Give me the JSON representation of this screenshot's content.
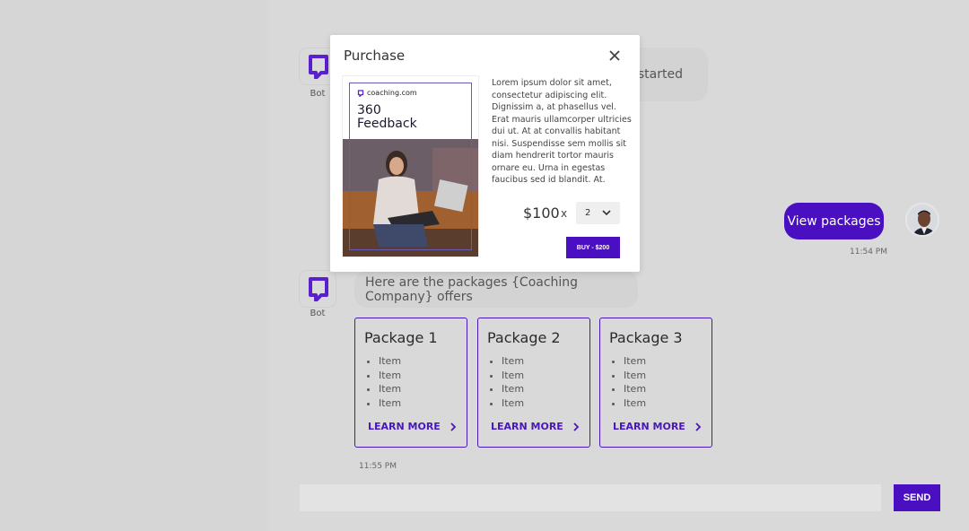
{
  "colors": {
    "accent": "#4a0fc0",
    "background": "#d9d9d9",
    "modal_bg": "#ffffff"
  },
  "chat": {
    "bot_label_1": "Bot",
    "bot_label_2": "Bot",
    "bot_message_1_visible": "t started",
    "user_message": "View packages",
    "user_timestamp": "11:54 PM",
    "bot_message_2": "Here are the packages {Coaching Company} offers",
    "bot_timestamp": "11:55 PM"
  },
  "packages": [
    {
      "title": "Package 1",
      "items": [
        "Item",
        "Item",
        "Item",
        "Item"
      ],
      "link": "LEARN MORE"
    },
    {
      "title": "Package 2",
      "items": [
        "Item",
        "Item",
        "Item",
        "Item"
      ],
      "link": "LEARN MORE"
    },
    {
      "title": "Package 3",
      "items": [
        "Item",
        "Item",
        "Item",
        "Item"
      ],
      "link": "LEARN MORE"
    }
  ],
  "composer": {
    "placeholder": "",
    "send_label": "SEND"
  },
  "modal": {
    "title": "Purchase",
    "image": {
      "brand": "coaching.com",
      "title_line1": "360",
      "title_line2": "Feedback"
    },
    "description": "Lorem ipsum dolor sit amet, consectetur adipiscing elit. Dignissim a, at phasellus vel. Erat mauris ullamcorper ultricies dui ut. At at convallis habitant nisi. Suspendisse sem mollis sit diam hendrerit tortor mauris ornare eu. Urna in egestas faucibus sed id blandit. At.",
    "price": "$100",
    "times": "x",
    "quantity": "2",
    "buy_label": "BUY - $200"
  }
}
